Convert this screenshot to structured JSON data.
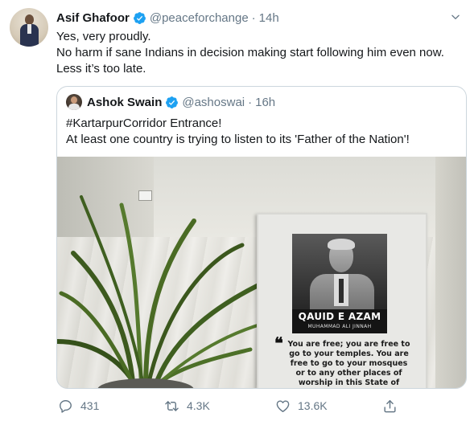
{
  "tweet": {
    "author_name": "Asif Ghafoor",
    "author_handle": "@peaceforchange",
    "separator": "·",
    "time": "14h",
    "text_lines": [
      "Yes, very proudly.",
      "No harm if sane Indians in decision making start following him even now.",
      "Less it’s too late."
    ]
  },
  "quoted_tweet": {
    "author_name": "Ashok Swain",
    "author_handle": "@ashoswai",
    "separator": "·",
    "time": "16h",
    "text_lines": [
      "#KartarpurCorridor Entrance!",
      "At least one country is trying to listen to its 'Father of the Nation'!"
    ]
  },
  "poster": {
    "title": "QAUID E AZAM",
    "subtitle": "MUHAMMAD ALI JINNAH",
    "quote_mark": "❝",
    "quote_lines": [
      "You are free; you are free to",
      "go to your temples. You are",
      "free to go to your mosques",
      "or to any other places of",
      "worship in this State of"
    ]
  },
  "actions": {
    "reply_count": "431",
    "retweet_count": "4.3K",
    "like_count": "13.6K"
  },
  "icons": {
    "verified": "verified-badge-icon",
    "caret": "chevron-down-icon",
    "reply": "reply-icon",
    "retweet": "retweet-icon",
    "like": "heart-icon",
    "share": "share-icon"
  },
  "colors": {
    "verified_blue": "#1da1f2",
    "secondary_text": "#657786",
    "border": "#ccd6dd"
  }
}
